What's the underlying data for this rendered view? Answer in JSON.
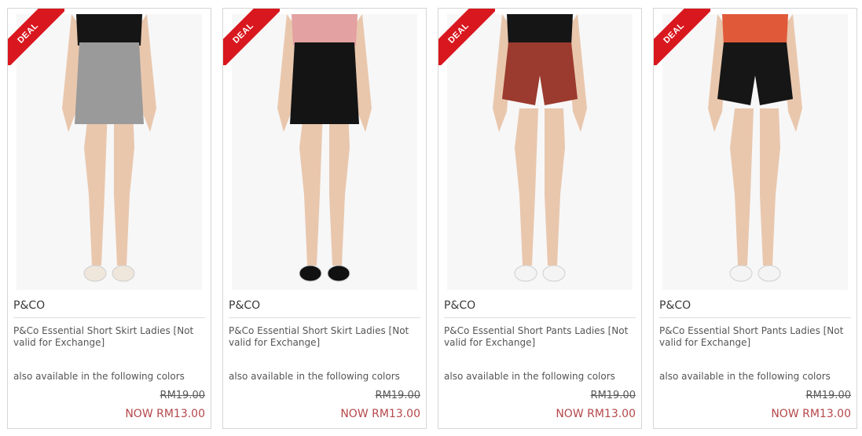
{
  "products": [
    {
      "badge": "DEAL",
      "brand": "P&CO",
      "title": "P&Co Essential Short Skirt Ladies [Not valid for Exchange]",
      "colors_note": "also available in the following colors",
      "old_price": "RM19.00",
      "new_price": "NOW RM13.00",
      "top_color": "#151515",
      "bottom_color": "#9a9a9a",
      "shoe_color": "#efe6dc",
      "garment": "skirt"
    },
    {
      "badge": "DEAL",
      "brand": "P&CO",
      "title": "P&Co Essential Short Skirt Ladies [Not valid for Exchange]",
      "colors_note": "also available in the following colors",
      "old_price": "RM19.00",
      "new_price": "NOW RM13.00",
      "top_color": "#e3a1a1",
      "bottom_color": "#141414",
      "shoe_color": "#111111",
      "garment": "skirt"
    },
    {
      "badge": "DEAL",
      "brand": "P&CO",
      "title": "P&Co Essential Short Pants Ladies [Not valid for Exchange]",
      "colors_note": "also available in the following colors",
      "old_price": "RM19.00",
      "new_price": "NOW RM13.00",
      "top_color": "#151515",
      "bottom_color": "#9b3a2e",
      "shoe_color": "#f4f4f4",
      "garment": "shorts"
    },
    {
      "badge": "DEAL",
      "brand": "P&CO",
      "title": "P&Co Essential Short Pants Ladies [Not valid for Exchange]",
      "colors_note": "also available in the following colors",
      "old_price": "RM19.00",
      "new_price": "NOW RM13.00",
      "top_color": "#e05a3a",
      "bottom_color": "#161616",
      "shoe_color": "#f4f4f4",
      "garment": "shorts"
    }
  ],
  "colors": {
    "badge": "#d9171e",
    "now_price": "#b5474a",
    "skin": "#e9c7ad"
  }
}
